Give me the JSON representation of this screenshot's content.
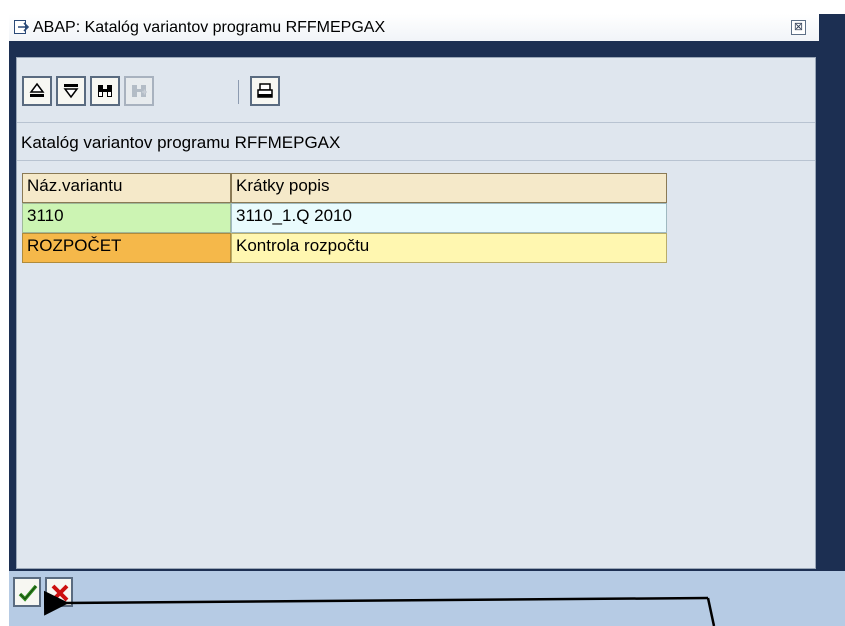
{
  "window": {
    "title": "ABAP: Katalóg variantov programu RFFMEPGAX",
    "close_glyph": "⊠"
  },
  "toolbar": {
    "buttons": [
      {
        "name": "sort-ascending",
        "icon": "sort-icon"
      },
      {
        "name": "filter",
        "icon": "filter-icon"
      },
      {
        "name": "find",
        "icon": "binoculars-icon"
      },
      {
        "name": "find-next",
        "icon": "find-next-icon",
        "disabled": true
      },
      {
        "name": "print",
        "icon": "print-icon"
      }
    ]
  },
  "heading": "Katalóg variantov programu RFFMEPGAX",
  "table": {
    "columns": [
      "Náz.variantu",
      "Krátky popis"
    ],
    "rows": [
      [
        "3110",
        "3110_1.Q 2010"
      ],
      [
        "ROZPOČET",
        "Kontrola rozpočtu"
      ]
    ]
  },
  "footer": {
    "confirm_icon": "checkmark-icon",
    "cancel_icon": "cancel-icon"
  },
  "colors": {
    "window_frame": "#1c2f52",
    "panel": "#dfe6ee",
    "header_cell": "#f5e9c9",
    "row1_key": "#ccf4b3",
    "row1_text": "#e9fbfd",
    "row2_key": "#f5b84a",
    "row2_text": "#fff7b0",
    "footer": "#b6cbe4"
  }
}
